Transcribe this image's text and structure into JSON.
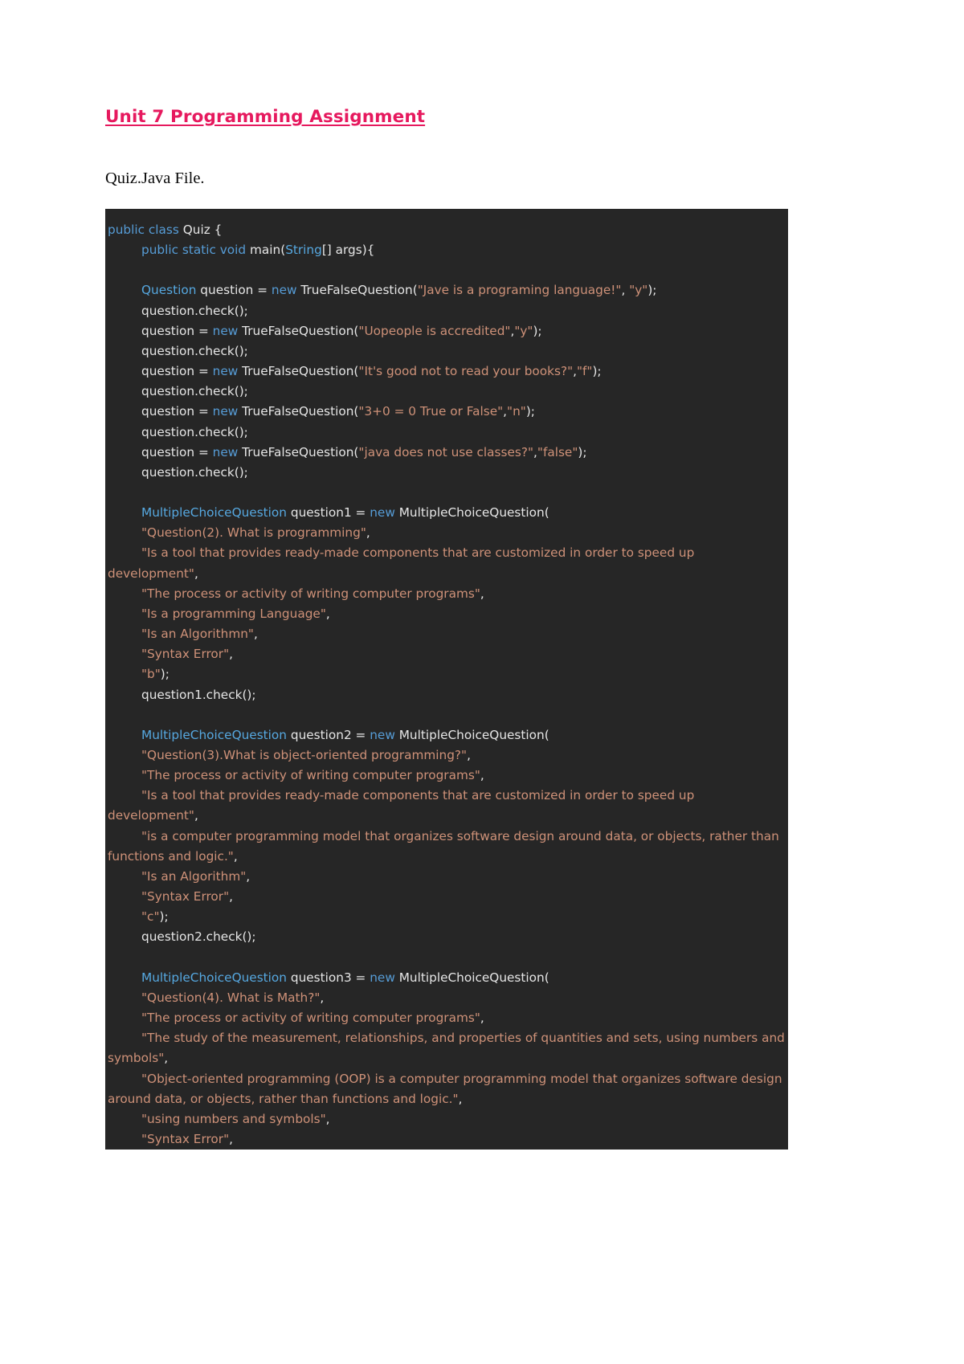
{
  "document": {
    "title": "Unit 7 Programming Assignment",
    "subtitle": "Quiz.Java File.",
    "title_color": "#E6195E",
    "body_color": "#0a0a0a"
  },
  "code_block": {
    "language": "java",
    "background_color": "#262626",
    "theme": {
      "keyword_color": "#569CD6",
      "type_color": "#4EC9E8",
      "string_color": "#CE9178",
      "plain_color": "#E6E6E6"
    },
    "lines": [
      {
        "id": "l1",
        "indent": 0,
        "tokens": [
          {
            "t": "kw",
            "v": "public class"
          },
          {
            "t": "pln",
            "v": " Quiz {"
          }
        ]
      },
      {
        "id": "l2",
        "indent": 1,
        "tokens": [
          {
            "t": "kw",
            "v": "public static void"
          },
          {
            "t": "pln",
            "v": " main("
          },
          {
            "t": "typ2",
            "v": "String"
          },
          {
            "t": "pln",
            "v": "[] args){"
          }
        ]
      },
      {
        "id": "l3",
        "indent": 0,
        "tokens": []
      },
      {
        "id": "l4",
        "indent": 1,
        "tokens": [
          {
            "t": "typ2",
            "v": "Question"
          },
          {
            "t": "pln",
            "v": " question = "
          },
          {
            "t": "kw",
            "v": "new"
          },
          {
            "t": "pln",
            "v": " TrueFalseQuestion("
          },
          {
            "t": "str",
            "v": "\"Jave is a programing language!\""
          },
          {
            "t": "pln",
            "v": ", "
          },
          {
            "t": "str",
            "v": "\"y\""
          },
          {
            "t": "pln",
            "v": ");"
          }
        ]
      },
      {
        "id": "l5",
        "indent": 1,
        "tokens": [
          {
            "t": "pln",
            "v": "question.check();"
          }
        ]
      },
      {
        "id": "l6",
        "indent": 1,
        "tokens": [
          {
            "t": "pln",
            "v": "question = "
          },
          {
            "t": "kw",
            "v": "new"
          },
          {
            "t": "pln",
            "v": " TrueFalseQuestion("
          },
          {
            "t": "str",
            "v": "\"Uopeople is accredited\""
          },
          {
            "t": "pln",
            "v": ","
          },
          {
            "t": "str",
            "v": "\"y\""
          },
          {
            "t": "pln",
            "v": ");"
          }
        ]
      },
      {
        "id": "l7",
        "indent": 1,
        "tokens": [
          {
            "t": "pln",
            "v": "question.check();"
          }
        ]
      },
      {
        "id": "l8",
        "indent": 1,
        "tokens": [
          {
            "t": "pln",
            "v": "question = "
          },
          {
            "t": "kw",
            "v": "new"
          },
          {
            "t": "pln",
            "v": " TrueFalseQuestion("
          },
          {
            "t": "str",
            "v": "\"It's good not to read your books?\""
          },
          {
            "t": "pln",
            "v": ","
          },
          {
            "t": "str",
            "v": "\"f\""
          },
          {
            "t": "pln",
            "v": ");"
          }
        ]
      },
      {
        "id": "l9",
        "indent": 1,
        "tokens": [
          {
            "t": "pln",
            "v": "question.check();"
          }
        ]
      },
      {
        "id": "l10",
        "indent": 1,
        "tokens": [
          {
            "t": "pln",
            "v": "question = "
          },
          {
            "t": "kw",
            "v": "new"
          },
          {
            "t": "pln",
            "v": " TrueFalseQuestion("
          },
          {
            "t": "str",
            "v": "\"3+0 = 0 True or False\""
          },
          {
            "t": "pln",
            "v": ","
          },
          {
            "t": "str",
            "v": "\"n\""
          },
          {
            "t": "pln",
            "v": ");"
          }
        ]
      },
      {
        "id": "l11",
        "indent": 1,
        "tokens": [
          {
            "t": "pln",
            "v": "question.check();"
          }
        ]
      },
      {
        "id": "l12",
        "indent": 1,
        "tokens": [
          {
            "t": "pln",
            "v": "question = "
          },
          {
            "t": "kw",
            "v": "new"
          },
          {
            "t": "pln",
            "v": " TrueFalseQuestion("
          },
          {
            "t": "str",
            "v": "\"java does not use classes?\""
          },
          {
            "t": "pln",
            "v": ","
          },
          {
            "t": "str",
            "v": "\"false\""
          },
          {
            "t": "pln",
            "v": ");"
          }
        ]
      },
      {
        "id": "l13",
        "indent": 1,
        "tokens": [
          {
            "t": "pln",
            "v": "question.check();"
          }
        ]
      },
      {
        "id": "l14",
        "indent": 0,
        "tokens": []
      },
      {
        "id": "l15",
        "indent": 1,
        "tokens": [
          {
            "t": "typ2",
            "v": "MultipleChoiceQuestion"
          },
          {
            "t": "pln",
            "v": " question1 = "
          },
          {
            "t": "kw",
            "v": "new"
          },
          {
            "t": "pln",
            "v": " MultipleChoiceQuestion("
          }
        ]
      },
      {
        "id": "l16",
        "indent": 1,
        "tokens": [
          {
            "t": "str",
            "v": "\"Question(2). What is programming\""
          },
          {
            "t": "pln",
            "v": ","
          }
        ]
      },
      {
        "id": "l17",
        "indent": 1,
        "tokens": [
          {
            "t": "str",
            "v": "\"Is a tool that provides ready-made components that are customized in order to speed up development\""
          },
          {
            "t": "pln",
            "v": ","
          }
        ]
      },
      {
        "id": "l18",
        "indent": 1,
        "tokens": [
          {
            "t": "str",
            "v": "\"The process or activity of writing computer programs\""
          },
          {
            "t": "pln",
            "v": ","
          }
        ]
      },
      {
        "id": "l19",
        "indent": 1,
        "tokens": [
          {
            "t": "str",
            "v": "\"Is a programming Language\""
          },
          {
            "t": "pln",
            "v": ","
          }
        ]
      },
      {
        "id": "l20",
        "indent": 1,
        "tokens": [
          {
            "t": "str",
            "v": "\"Is an Algorithmn\""
          },
          {
            "t": "pln",
            "v": ","
          }
        ]
      },
      {
        "id": "l21",
        "indent": 1,
        "tokens": [
          {
            "t": "str",
            "v": "\"Syntax Error\""
          },
          {
            "t": "pln",
            "v": ","
          }
        ]
      },
      {
        "id": "l22",
        "indent": 1,
        "tokens": [
          {
            "t": "str",
            "v": "\"b\""
          },
          {
            "t": "pln",
            "v": ");"
          }
        ]
      },
      {
        "id": "l23",
        "indent": 1,
        "tokens": [
          {
            "t": "pln",
            "v": "question1.check();"
          }
        ]
      },
      {
        "id": "l24",
        "indent": 0,
        "tokens": []
      },
      {
        "id": "l25",
        "indent": 1,
        "tokens": [
          {
            "t": "typ2",
            "v": "MultipleChoiceQuestion"
          },
          {
            "t": "pln",
            "v": " question2 = "
          },
          {
            "t": "kw",
            "v": "new"
          },
          {
            "t": "pln",
            "v": " MultipleChoiceQuestion("
          }
        ]
      },
      {
        "id": "l26",
        "indent": 1,
        "tokens": [
          {
            "t": "str",
            "v": "\"Question(3).What is object-oriented programming?\""
          },
          {
            "t": "pln",
            "v": ","
          }
        ]
      },
      {
        "id": "l27",
        "indent": 1,
        "tokens": [
          {
            "t": "str",
            "v": "\"The process or activity of writing computer programs\""
          },
          {
            "t": "pln",
            "v": ","
          }
        ]
      },
      {
        "id": "l28",
        "indent": 1,
        "tokens": [
          {
            "t": "str",
            "v": "\"Is a tool that provides ready-made components that are customized in order to speed up development\""
          },
          {
            "t": "pln",
            "v": ","
          }
        ]
      },
      {
        "id": "l29",
        "indent": 1,
        "tokens": [
          {
            "t": "str",
            "v": "\"is a computer programming model that organizes software design around data, or objects, rather than functions and logic.\""
          },
          {
            "t": "pln",
            "v": ","
          }
        ]
      },
      {
        "id": "l30",
        "indent": 1,
        "tokens": [
          {
            "t": "str",
            "v": "\"Is an Algorithm\""
          },
          {
            "t": "pln",
            "v": ","
          }
        ]
      },
      {
        "id": "l31",
        "indent": 1,
        "tokens": [
          {
            "t": "str",
            "v": "\"Syntax Error\""
          },
          {
            "t": "pln",
            "v": ","
          }
        ]
      },
      {
        "id": "l32",
        "indent": 1,
        "tokens": [
          {
            "t": "str",
            "v": "\"c\""
          },
          {
            "t": "pln",
            "v": ");"
          }
        ]
      },
      {
        "id": "l33",
        "indent": 1,
        "tokens": [
          {
            "t": "pln",
            "v": "question2.check();"
          }
        ]
      },
      {
        "id": "l34",
        "indent": 0,
        "tokens": []
      },
      {
        "id": "l35",
        "indent": 1,
        "tokens": [
          {
            "t": "typ2",
            "v": "MultipleChoiceQuestion"
          },
          {
            "t": "pln",
            "v": " question3 = "
          },
          {
            "t": "kw",
            "v": "new"
          },
          {
            "t": "pln",
            "v": " MultipleChoiceQuestion("
          }
        ]
      },
      {
        "id": "l36",
        "indent": 1,
        "tokens": [
          {
            "t": "str",
            "v": "\"Question(4). What is Math?\""
          },
          {
            "t": "pln",
            "v": ","
          }
        ]
      },
      {
        "id": "l37",
        "indent": 1,
        "tokens": [
          {
            "t": "str",
            "v": "\"The process or activity of writing computer programs\""
          },
          {
            "t": "pln",
            "v": ","
          }
        ]
      },
      {
        "id": "l38",
        "indent": 1,
        "tokens": [
          {
            "t": "str",
            "v": "\"The study of the measurement, relationships, and properties of quantities and sets, using numbers and symbols\""
          },
          {
            "t": "pln",
            "v": ","
          }
        ]
      },
      {
        "id": "l39",
        "indent": 1,
        "tokens": [
          {
            "t": "str",
            "v": "\"Object-oriented programming (OOP) is a computer programming model that organizes software design around data, or objects, rather than functions and logic.\""
          },
          {
            "t": "pln",
            "v": ","
          }
        ]
      },
      {
        "id": "l40",
        "indent": 1,
        "tokens": [
          {
            "t": "str",
            "v": "\"using numbers and symbols\""
          },
          {
            "t": "pln",
            "v": ","
          }
        ]
      },
      {
        "id": "l41",
        "indent": 1,
        "tokens": [
          {
            "t": "str",
            "v": "\"Syntax Error\""
          },
          {
            "t": "pln",
            "v": ","
          }
        ]
      }
    ]
  }
}
